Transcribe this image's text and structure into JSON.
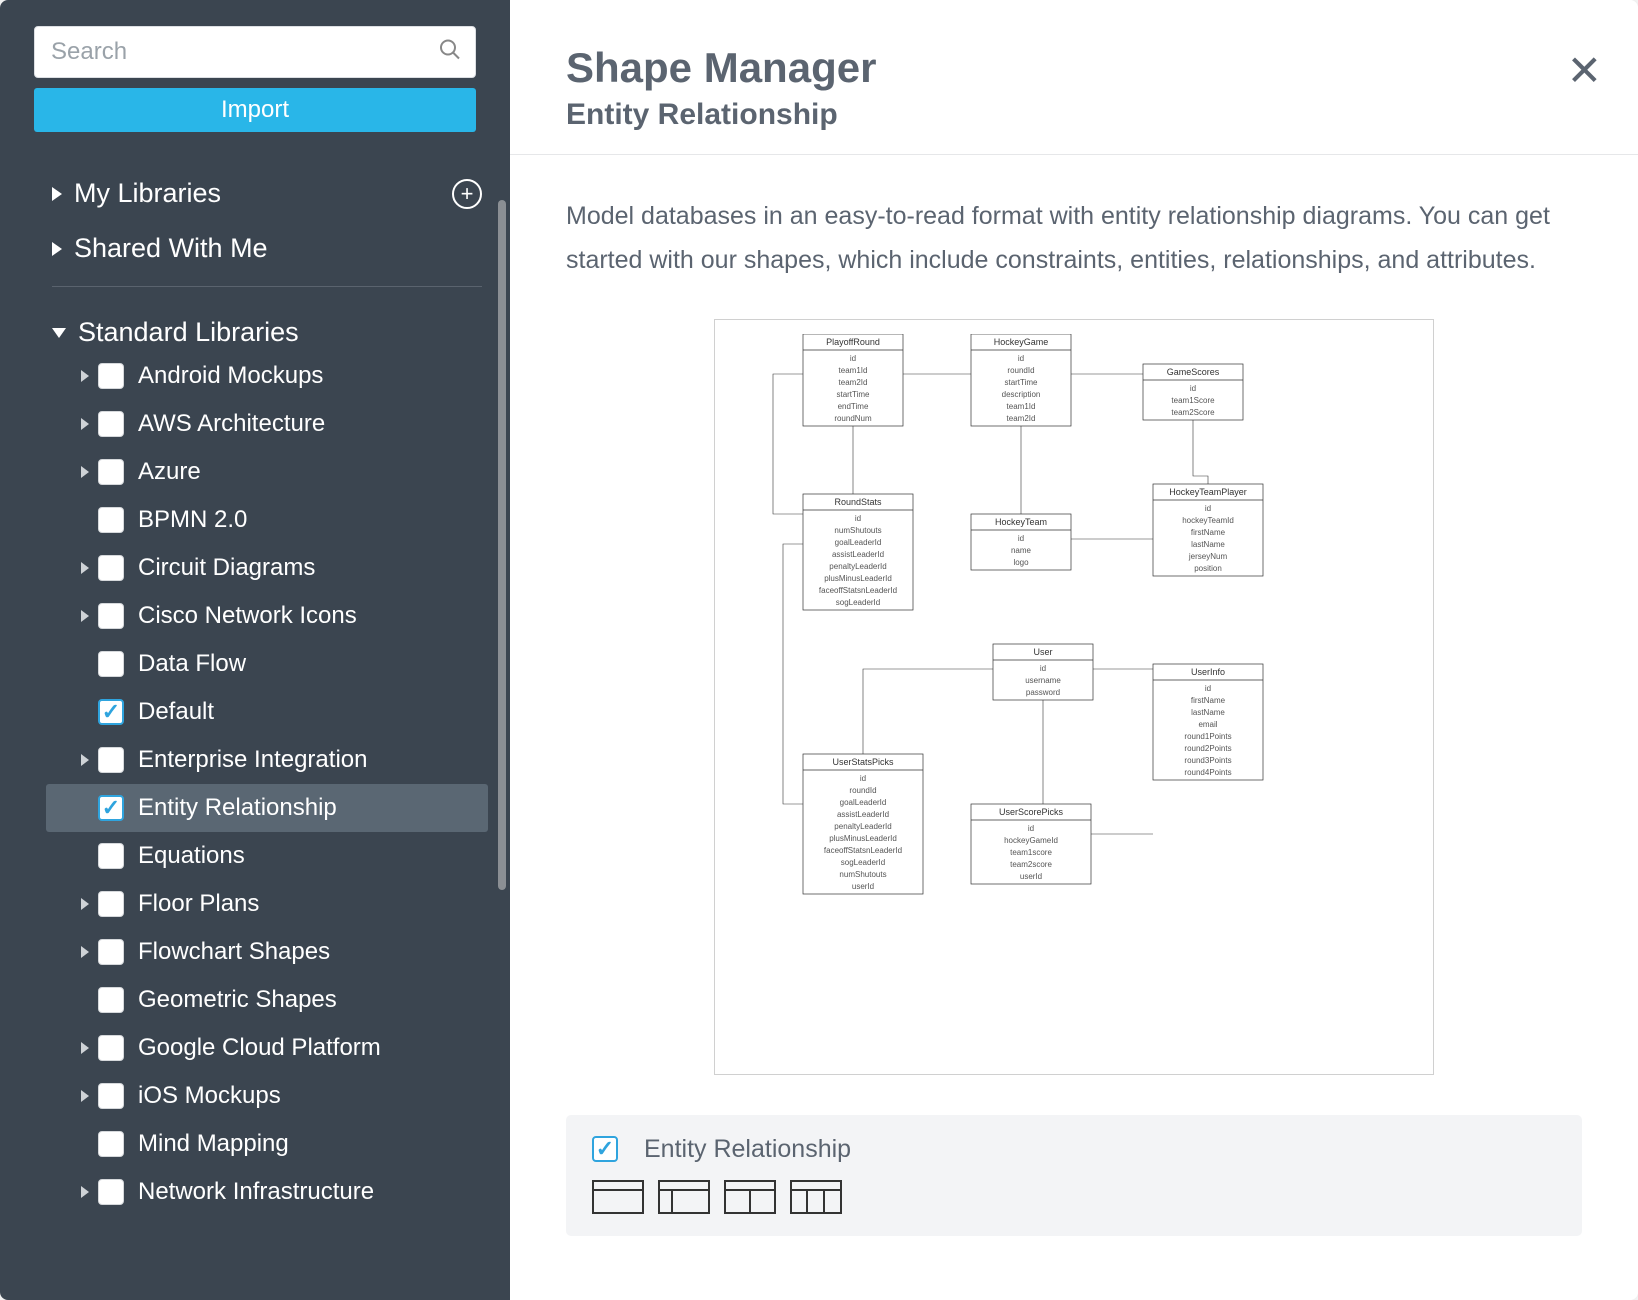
{
  "sidebar": {
    "search_placeholder": "Search",
    "import_label": "Import",
    "sections": {
      "my_libraries": "My Libraries",
      "shared": "Shared With Me",
      "standard": "Standard Libraries"
    },
    "libs": [
      {
        "label": "Android Mockups",
        "checked": false,
        "expandable": true
      },
      {
        "label": "AWS Architecture",
        "checked": false,
        "expandable": true
      },
      {
        "label": "Azure",
        "checked": false,
        "expandable": true
      },
      {
        "label": "BPMN 2.0",
        "checked": false,
        "expandable": false
      },
      {
        "label": "Circuit Diagrams",
        "checked": false,
        "expandable": true
      },
      {
        "label": "Cisco Network Icons",
        "checked": false,
        "expandable": true
      },
      {
        "label": "Data Flow",
        "checked": false,
        "expandable": false
      },
      {
        "label": "Default",
        "checked": true,
        "expandable": false
      },
      {
        "label": "Enterprise Integration",
        "checked": false,
        "expandable": true
      },
      {
        "label": "Entity Relationship",
        "checked": true,
        "expandable": false,
        "selected": true
      },
      {
        "label": "Equations",
        "checked": false,
        "expandable": false
      },
      {
        "label": "Floor Plans",
        "checked": false,
        "expandable": true
      },
      {
        "label": "Flowchart Shapes",
        "checked": false,
        "expandable": true
      },
      {
        "label": "Geometric Shapes",
        "checked": false,
        "expandable": false
      },
      {
        "label": "Google Cloud Platform",
        "checked": false,
        "expandable": true
      },
      {
        "label": "iOS Mockups",
        "checked": false,
        "expandable": true
      },
      {
        "label": "Mind Mapping",
        "checked": false,
        "expandable": false
      },
      {
        "label": "Network Infrastructure",
        "checked": false,
        "expandable": true
      }
    ]
  },
  "main": {
    "title": "Shape Manager",
    "subtitle": "Entity Relationship",
    "description": "Model databases in an easy-to-read format with entity relationship diagrams. You can get started with our shapes, which include constraints, entities, relationships, and attributes.",
    "shape_set_label": "Entity Relationship",
    "entities": {
      "playoff": {
        "title": "PlayoffRound",
        "attrs": [
          "id",
          "team1Id",
          "team2Id",
          "startTime",
          "endTime",
          "roundNum"
        ]
      },
      "game": {
        "title": "HockeyGame",
        "attrs": [
          "id",
          "roundId",
          "startTime",
          "description",
          "team1Id",
          "team2Id"
        ]
      },
      "scores": {
        "title": "GameScores",
        "attrs": [
          "id",
          "team1Score",
          "team2Score"
        ]
      },
      "roundstats": {
        "title": "RoundStats",
        "attrs": [
          "id",
          "numShutouts",
          "goalLeaderId",
          "assistLeaderId",
          "penaltyLeaderId",
          "plusMinusLeaderId",
          "faceoffStatsnLeaderId",
          "sogLeaderId"
        ]
      },
      "team": {
        "title": "HockeyTeam",
        "attrs": [
          "id",
          "name",
          "logo"
        ]
      },
      "player": {
        "title": "HockeyTeamPlayer",
        "attrs": [
          "id",
          "hockeyTeamId",
          "firstName",
          "lastName",
          "jerseyNum",
          "position"
        ]
      },
      "user": {
        "title": "User",
        "attrs": [
          "id",
          "username",
          "password"
        ]
      },
      "userinfo": {
        "title": "UserInfo",
        "attrs": [
          "id",
          "firstName",
          "lastName",
          "email",
          "round1Points",
          "round2Points",
          "round3Points",
          "round4Points"
        ]
      },
      "statspicks": {
        "title": "UserStatsPicks",
        "attrs": [
          "id",
          "roundId",
          "goalLeaderId",
          "assistLeaderId",
          "penaltyLeaderId",
          "plusMinusLeaderId",
          "faceoffStatsnLeaderId",
          "sogLeaderId",
          "numShutouts",
          "userId"
        ]
      },
      "scorepicks": {
        "title": "UserScorePicks",
        "attrs": [
          "id",
          "hockeyGameId",
          "team1score",
          "team2score",
          "userId"
        ]
      }
    }
  }
}
